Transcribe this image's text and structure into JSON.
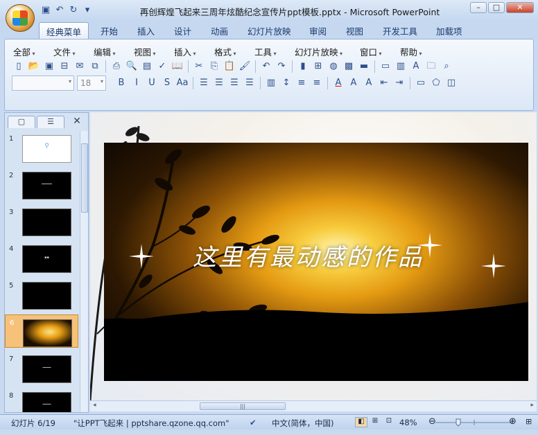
{
  "window": {
    "title": "再创辉煌飞起来三周年炫酷纪念宣传片ppt模板.pptx - Microsoft PowerPoint",
    "controls": [
      "–",
      "□",
      "✕"
    ]
  },
  "qat": {
    "icons": [
      "save-icon",
      "undo-icon",
      "redo-icon",
      "customize-icon"
    ]
  },
  "ribbon": {
    "tabs": [
      {
        "label": "经典菜单",
        "active": true
      },
      {
        "label": "开始"
      },
      {
        "label": "插入"
      },
      {
        "label": "设计"
      },
      {
        "label": "动画"
      },
      {
        "label": "幻灯片放映"
      },
      {
        "label": "审阅"
      },
      {
        "label": "视图"
      },
      {
        "label": "开发工具"
      },
      {
        "label": "加载项"
      }
    ],
    "menus": [
      "全部",
      "文件",
      "编辑",
      "视图",
      "插入",
      "格式",
      "工具",
      "幻灯片放映",
      "窗口",
      "帮助"
    ],
    "font_size": "18"
  },
  "slides": [
    {
      "num": "1",
      "bg": "#ffffff"
    },
    {
      "num": "2",
      "bg": "#000000"
    },
    {
      "num": "3",
      "bg": "#000000"
    },
    {
      "num": "4",
      "bg": "#000000"
    },
    {
      "num": "5",
      "bg": "#000000"
    },
    {
      "num": "6",
      "bg": "#000000",
      "selected": true
    },
    {
      "num": "7",
      "bg": "#000000"
    },
    {
      "num": "8",
      "bg": "#000000"
    }
  ],
  "slide": {
    "title": "这里有最动感的作品"
  },
  "status": {
    "slide_indicator": "幻灯片 6/19",
    "theme": "\"让PPT飞起来 | pptshare.qzone.qq.com\"",
    "language": "中文(简体，中国)",
    "zoom": "48%"
  }
}
